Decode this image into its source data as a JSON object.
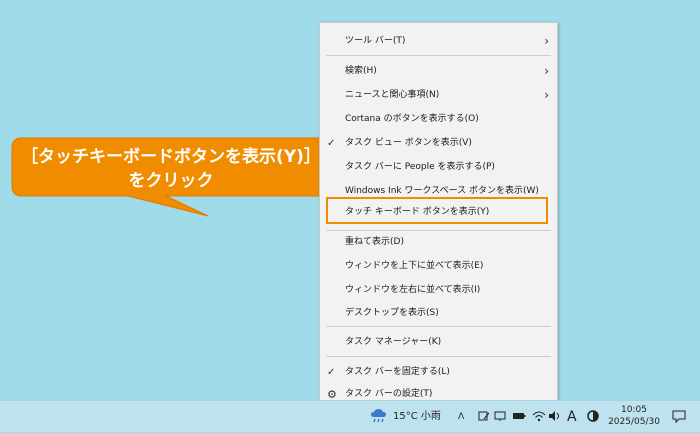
{
  "callout": {
    "line1": "［タッチキーボードボタンを表示(Y)］",
    "line2": "をクリック",
    "color": "#f08c00"
  },
  "menu": {
    "items": [
      {
        "label": "ツール バー(T)",
        "submenu": true,
        "checked": false
      },
      {
        "label": "検索(H)",
        "submenu": true,
        "checked": false
      },
      {
        "label": "ニュースと関心事項(N)",
        "submenu": true,
        "checked": false
      },
      {
        "label": "Cortana のボタンを表示する(O)",
        "submenu": false,
        "checked": false
      },
      {
        "label": "タスク ビュー ボタンを表示(V)",
        "submenu": false,
        "checked": true
      },
      {
        "label": "タスク バーに People を表示する(P)",
        "submenu": false,
        "checked": false
      },
      {
        "label": "Windows Ink ワークスペース ボタンを表示(W)",
        "submenu": false,
        "checked": false
      },
      {
        "label": "タッチ キーボード ボタンを表示(Y)",
        "submenu": false,
        "checked": false
      },
      {
        "label": "重ねて表示(D)",
        "submenu": false,
        "checked": false
      },
      {
        "label": "ウィンドウを上下に並べて表示(E)",
        "submenu": false,
        "checked": false
      },
      {
        "label": "ウィンドウを左右に並べて表示(I)",
        "submenu": false,
        "checked": false
      },
      {
        "label": "デスクトップを表示(S)",
        "submenu": false,
        "checked": false
      },
      {
        "label": "タスク マネージャー(K)",
        "submenu": false,
        "checked": false
      },
      {
        "label": "タスク バーを固定する(L)",
        "submenu": false,
        "checked": true
      },
      {
        "label": "タスク バーの設定(T)",
        "submenu": false,
        "checked": false,
        "icon": "gear-icon"
      }
    ],
    "chevron": "›",
    "check": "✓",
    "gear": "⚙"
  },
  "taskbar": {
    "weather_icon": "cloud-rain-icon",
    "weather": "15°C 小雨",
    "ime": "A",
    "time": "10:05",
    "date": "2025/05/30",
    "notification_icon": "notification-icon"
  }
}
